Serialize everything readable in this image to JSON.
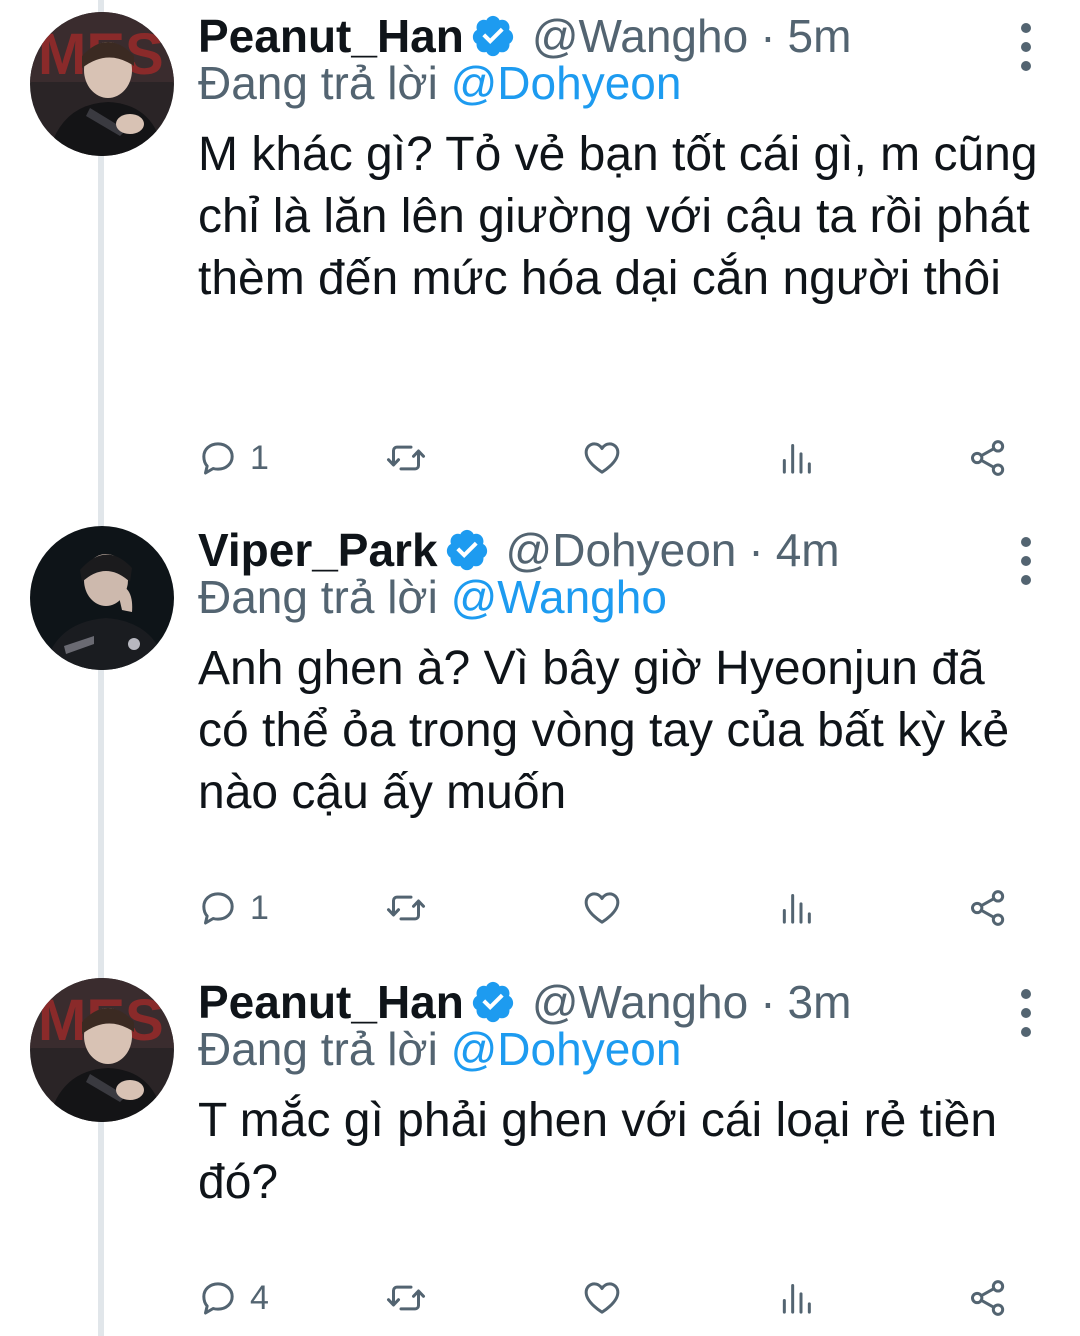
{
  "colors": {
    "accent": "#1d9bf0",
    "muted": "#536471",
    "text": "#0f1419",
    "thread_line": "#e1e6ea"
  },
  "reply_prefix": "Đang trả lời",
  "tweets": [
    {
      "display_name": "Peanut_Han",
      "handle": "@Wangho",
      "separator": "·",
      "time": "5m",
      "replying_to": "@Dohyeon",
      "text": "M khác gì? Tỏ vẻ bạn tốt cái gì, m cũng chỉ là lăn lên giường với cậu ta rồi phát thèm đến mức hóa dại cắn người thôi",
      "reply_count": "1",
      "icons": [
        "reply-icon",
        "retweet-icon",
        "like-icon",
        "analytics-icon",
        "share-icon"
      ]
    },
    {
      "display_name": "Viper_Park",
      "handle": "@Dohyeon",
      "separator": "·",
      "time": "4m",
      "replying_to": "@Wangho",
      "text": "Anh ghen à? Vì bây giờ Hyeonjun đã có thể ỏa trong vòng tay của bất kỳ kẻ nào cậu ấy muốn",
      "reply_count": "1",
      "icons": [
        "reply-icon",
        "retweet-icon",
        "like-icon",
        "analytics-icon",
        "share-icon"
      ]
    },
    {
      "display_name": "Peanut_Han",
      "handle": "@Wangho",
      "separator": "·",
      "time": "3m",
      "replying_to": "@Dohyeon",
      "text": "T mắc gì phải ghen với cái loại rẻ tiền đó?",
      "reply_count": "4",
      "icons": [
        "reply-icon",
        "retweet-icon",
        "like-icon",
        "analytics-icon",
        "share-icon"
      ]
    }
  ]
}
